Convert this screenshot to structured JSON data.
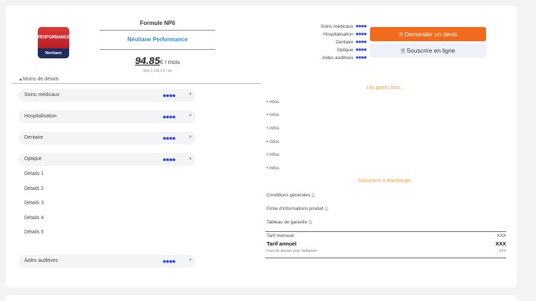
{
  "logo": {
    "top": "PERFORMANCE",
    "bottom": "Néoliane"
  },
  "header": {
    "formule": "Formule NP6",
    "product": "Néoliane Performance",
    "price": "94.85",
    "price_unit": "€ / mois",
    "annual": "Soit 1,138.2 € / an"
  },
  "toggle": {
    "arrow": "▲",
    "label": "Moins de détails"
  },
  "categories": [
    {
      "label": "Soins médicaux",
      "dots": "●●●●",
      "arrow": "▼"
    },
    {
      "label": "Hospitalisation",
      "dots": "●●●●",
      "arrow": "▼"
    },
    {
      "label": "Dentaire",
      "dots": "●●●●",
      "arrow": "▼"
    },
    {
      "label": "Optique",
      "dots": "●●●●",
      "arrow": "▲"
    },
    {
      "label": "Aides auditives",
      "dots": "●●●●",
      "arrow": "▼"
    }
  ],
  "details": [
    "Détails 1",
    "Détails 2",
    "Détails 3",
    "Détails 4",
    "Détails 5"
  ],
  "overview": [
    {
      "label": "Soins médicaux",
      "dots": "●●●●"
    },
    {
      "label": "Hospitalisation",
      "dots": "●●●●"
    },
    {
      "label": "Dentaire",
      "dots": "●●●●"
    },
    {
      "label": "Optique",
      "dots": "●●●●"
    },
    {
      "label": "Aides auditives",
      "dots": "●●●●"
    }
  ],
  "buttons": {
    "devis_icon": "🗎",
    "devis": "Demander un devis",
    "souscrire_icon": "🗎",
    "souscrire": "Souscrire en ligne"
  },
  "points_forts": {
    "title": "Les points forts :",
    "items": [
      "• infos",
      "• infos",
      "• infos",
      "• infos",
      "• infos",
      "• infos"
    ]
  },
  "documents": {
    "title": "Document à telecharger",
    "items": [
      {
        "label": "Conditions générales",
        "icon": "⎙"
      },
      {
        "label": "Fiche d'informations produit",
        "icon": "⎙"
      },
      {
        "label": "Tableau de garantie",
        "icon": "⎙"
      }
    ]
  },
  "tarifs": [
    {
      "label": "Tarif mensuel",
      "value": "XXX"
    },
    {
      "label": "Tarif annuel",
      "value": "XXX"
    },
    {
      "label": "Frais de dossier pour l'adhesion :",
      "value": "XXX"
    }
  ],
  "colors": {
    "accent": "#f26a1b",
    "dots": "#2e3cf0",
    "link": "#2a8bd6",
    "section": "#f39c3a"
  }
}
